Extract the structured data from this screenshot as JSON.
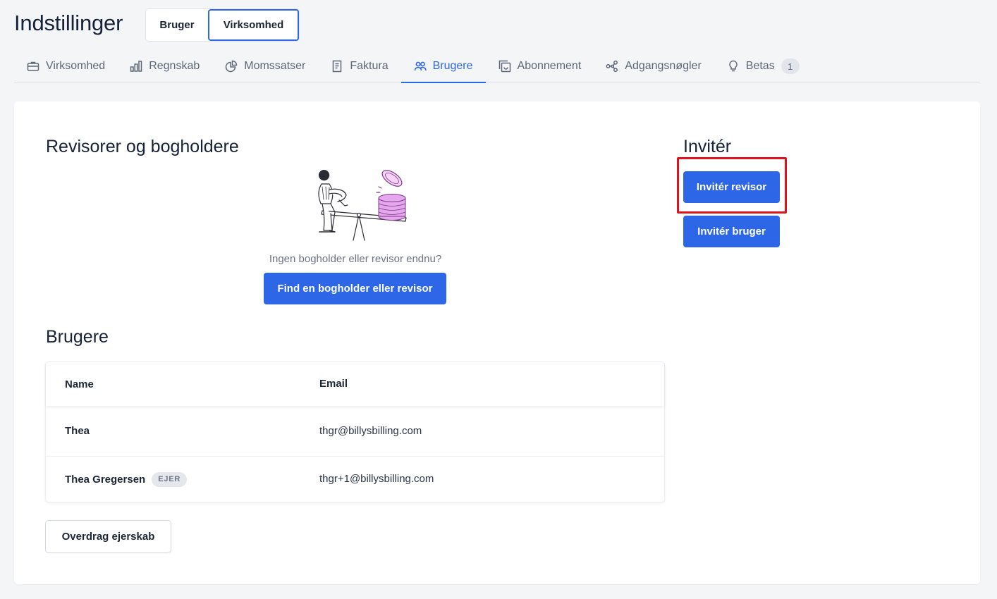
{
  "header": {
    "title": "Indstillinger",
    "scope_toggle": {
      "user_label": "Bruger",
      "company_label": "Virksomhed",
      "selected": "Virksomhed"
    }
  },
  "tabs": [
    {
      "label": "Virksomhed",
      "icon": "briefcase-icon"
    },
    {
      "label": "Regnskab",
      "icon": "bar-chart-icon"
    },
    {
      "label": "Momssatser",
      "icon": "pie-chart-icon"
    },
    {
      "label": "Faktura",
      "icon": "document-icon"
    },
    {
      "label": "Brugere",
      "icon": "users-icon",
      "active": true
    },
    {
      "label": "Abonnement",
      "icon": "subscription-icon"
    },
    {
      "label": "Adgangsnøgler",
      "icon": "share-nodes-icon"
    },
    {
      "label": "Betas",
      "icon": "lightbulb-icon",
      "badge": "1"
    }
  ],
  "accountants": {
    "title": "Revisorer og bogholdere",
    "empty_text": "Ingen bogholder eller revisor endnu?",
    "find_button": "Find en bogholder eller revisor"
  },
  "users": {
    "title": "Brugere",
    "columns": {
      "name": "Name",
      "email": "Email"
    },
    "rows": [
      {
        "name": "Thea",
        "email": "thgr@billysbilling.com",
        "badge": ""
      },
      {
        "name": "Thea Gregersen",
        "email": "thgr+1@billysbilling.com",
        "badge": "EJER"
      }
    ],
    "transfer_button": "Overdrag ejerskab"
  },
  "invite": {
    "title": "Invitér",
    "invite_accountant_button": "Invitér revisor",
    "invite_user_button": "Invitér bruger"
  },
  "colors": {
    "primary": "#2d67e8",
    "background": "#f4f5f7",
    "highlight": "#e0131b",
    "illustration_accent": "#e6a7ee"
  }
}
